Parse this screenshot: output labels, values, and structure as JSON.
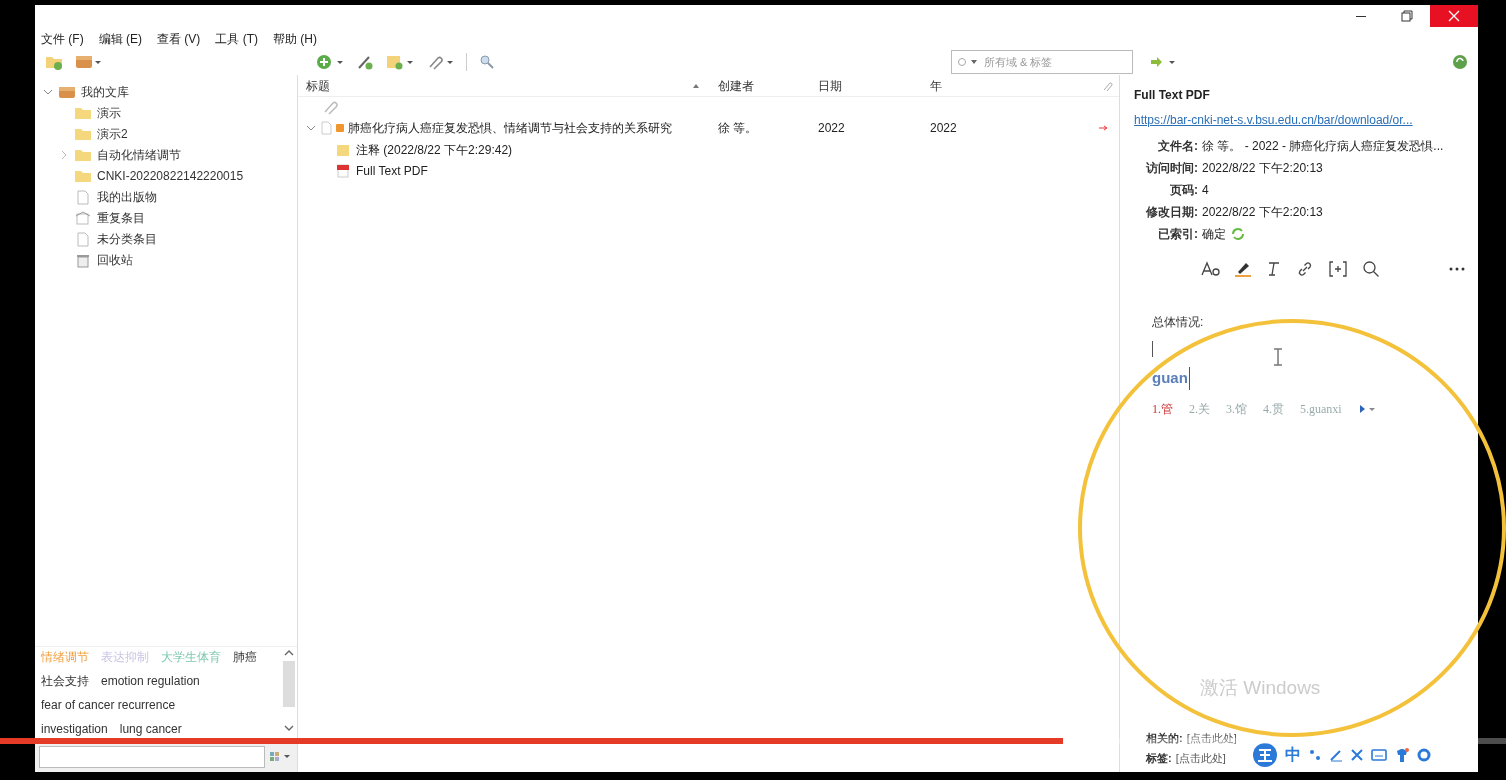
{
  "menu": [
    {
      "label": "文件 (F)"
    },
    {
      "label": "编辑 (E)"
    },
    {
      "label": "查看 (V)"
    },
    {
      "label": "工具 (T)"
    },
    {
      "label": "帮助 (H)"
    }
  ],
  "collections": [
    {
      "label": "我的文库",
      "kind": "library",
      "expanded": true,
      "children": [
        {
          "label": "演示",
          "kind": "folder"
        },
        {
          "label": "演示2",
          "kind": "folder"
        },
        {
          "label": "自动化情绪调节",
          "kind": "folder",
          "expanded": false
        },
        {
          "label": "CNKI-20220822142220015",
          "kind": "folder"
        },
        {
          "label": "我的出版物",
          "kind": "publications"
        },
        {
          "label": "重复条目",
          "kind": "duplicates"
        },
        {
          "label": "未分类条目",
          "kind": "unfiled"
        },
        {
          "label": "回收站",
          "kind": "trash"
        }
      ]
    }
  ],
  "tag_selector": {
    "lines": [
      [
        {
          "label": "情绪调节",
          "color": "#f0a040"
        },
        {
          "label": "表达抑制",
          "color": "#c8c4e4"
        },
        {
          "label": "大学生体育",
          "color": "#7cc8b0"
        },
        {
          "label": "肺癌"
        }
      ],
      [
        {
          "label": "社会支持"
        },
        {
          "label": "emotion regulation"
        }
      ],
      [
        {
          "label": "fear of cancer recurrence"
        }
      ],
      [
        {
          "label": "investigation"
        },
        {
          "label": "lung cancer"
        }
      ]
    ]
  },
  "search": {
    "placeholder": "所有域 & 标签"
  },
  "items_table": {
    "columns": [
      "标题",
      "创建者",
      "日期",
      "年"
    ],
    "rows": [
      {
        "kind": "item",
        "title": "肺癌化疗病人癌症复发恐惧、情绪调节与社会支持的关系研究",
        "creator": "徐 等。",
        "date": "2022",
        "year": "2022",
        "expanded": true,
        "children": [
          {
            "kind": "note",
            "title": "注释 (2022/8/22 下午2:29:42)"
          },
          {
            "kind": "pdf",
            "title": "Full Text PDF"
          }
        ]
      }
    ]
  },
  "attachment": {
    "title": "Full Text PDF",
    "url": "https://bar-cnki-net-s.v.bsu.edu.cn/bar/download/or...",
    "fields": [
      {
        "label": "文件名:",
        "value": "徐 等。 - 2022 - 肺癌化疗病人癌症复发恐惧..."
      },
      {
        "label": "访问时间:",
        "value": "2022/8/22 下午2:20:13"
      },
      {
        "label": "页码:",
        "value": "4"
      },
      {
        "label": "修改日期:",
        "value": "2022/8/22 下午2:20:13"
      },
      {
        "label": "已索引:",
        "value": "确定",
        "kind": "indexed"
      }
    ]
  },
  "note": {
    "text": "总体情况:",
    "composition": "guan",
    "candidates": [
      "1.管",
      "2.关",
      "3.馆",
      "4.贯",
      "5.guanxi"
    ]
  },
  "related": {
    "label": "相关的:",
    "value": "[点击此处]"
  },
  "tags": {
    "label": "标签:",
    "value": "[点击此处]"
  },
  "os_notice": "激活 Windows",
  "ime_toolbar": [
    {
      "label": "中"
    }
  ],
  "video": {
    "progress": {
      "level": 0.706
    }
  }
}
